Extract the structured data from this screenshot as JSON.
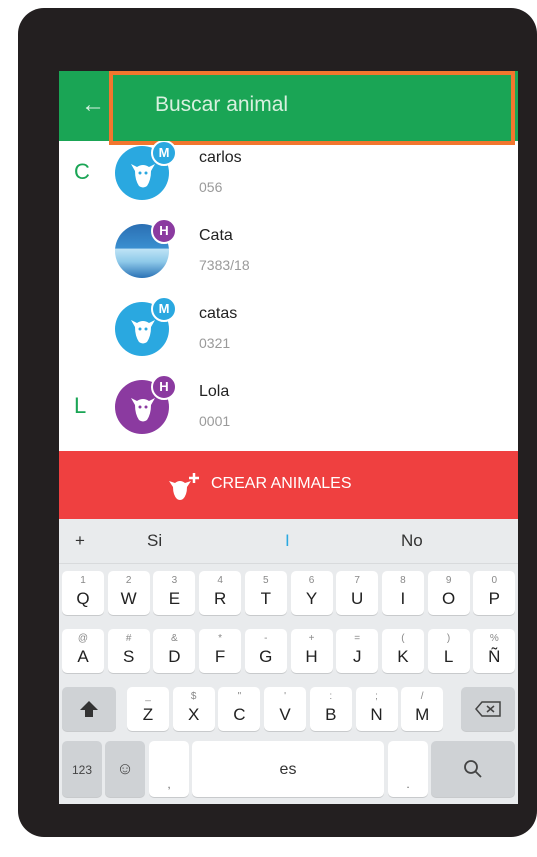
{
  "search": {
    "placeholder": "Buscar animal"
  },
  "contacts": [
    {
      "letter": "C",
      "name": "carlos",
      "code": "056",
      "badge": "M"
    },
    {
      "letter": "",
      "name": "Cata",
      "code": "7383/18",
      "badge": "H"
    },
    {
      "letter": "",
      "name": "catas",
      "code": "0321",
      "badge": "M"
    },
    {
      "letter": "L",
      "name": "Lola",
      "code": "0001",
      "badge": "H"
    }
  ],
  "create_button": {
    "label": "CREAR ANIMALES"
  },
  "keyboard": {
    "suggestions": [
      "+",
      "Si",
      "I",
      "No"
    ],
    "row1": [
      {
        "k": "Q",
        "s": "1"
      },
      {
        "k": "W",
        "s": "2"
      },
      {
        "k": "E",
        "s": "3"
      },
      {
        "k": "R",
        "s": "4"
      },
      {
        "k": "T",
        "s": "5"
      },
      {
        "k": "Y",
        "s": "6"
      },
      {
        "k": "U",
        "s": "7"
      },
      {
        "k": "I",
        "s": "8"
      },
      {
        "k": "O",
        "s": "9"
      },
      {
        "k": "P",
        "s": "0"
      }
    ],
    "row2": [
      {
        "k": "A",
        "s": "@"
      },
      {
        "k": "S",
        "s": "#"
      },
      {
        "k": "D",
        "s": "&"
      },
      {
        "k": "F",
        "s": "*"
      },
      {
        "k": "G",
        "s": "-"
      },
      {
        "k": "H",
        "s": "+"
      },
      {
        "k": "J",
        "s": "="
      },
      {
        "k": "K",
        "s": "("
      },
      {
        "k": "L",
        "s": ")"
      },
      {
        "k": "Ñ",
        "s": "%"
      }
    ],
    "row3": [
      {
        "k": "Z",
        "s": "_"
      },
      {
        "k": "X",
        "s": "$"
      },
      {
        "k": "C",
        "s": "\""
      },
      {
        "k": "V",
        "s": "'"
      },
      {
        "k": "B",
        "s": ":"
      },
      {
        "k": "N",
        "s": ";"
      },
      {
        "k": "M",
        "s": "/"
      }
    ],
    "num_label": "123",
    "space_label": "es",
    "comma_label": ",",
    "period_label": "."
  }
}
